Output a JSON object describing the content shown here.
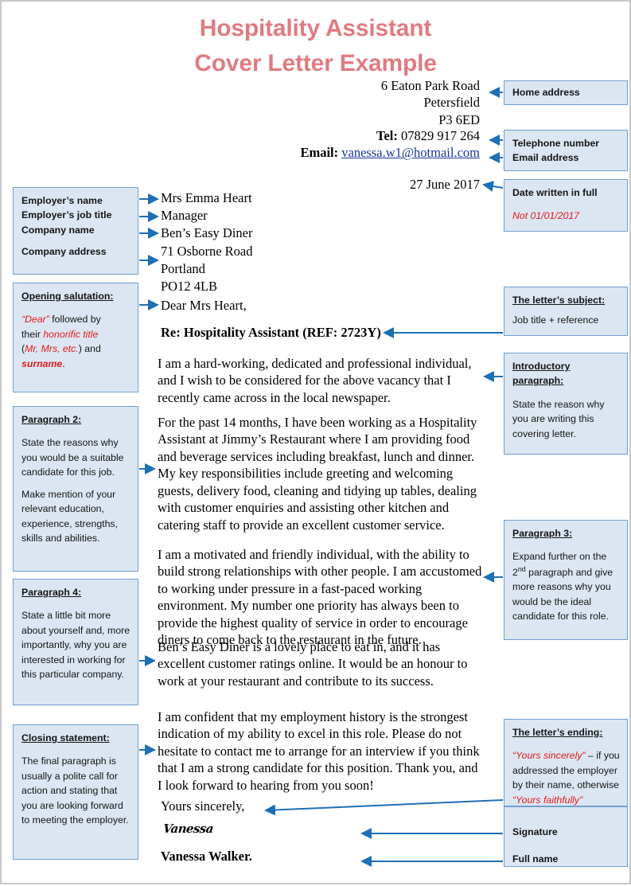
{
  "title": {
    "line1": "Hospitality Assistant",
    "line2": "Cover Letter Example",
    "color": "#e07b80"
  },
  "letter": {
    "home_address": [
      "6 Eaton Park Road",
      "Petersfield",
      "P3 6ED"
    ],
    "tel_label": "Tel:",
    "tel_value": " 07829 917 264",
    "email_label": "Email:",
    "email_value": "vanessa.w1@hotmail.com",
    "date": "27 June 2017",
    "employer": [
      "Mrs Emma Heart",
      "Manager",
      "Ben’s Easy Diner",
      "71 Osborne Road",
      "Portland",
      "PO12 4LB"
    ],
    "salutation": "Dear Mrs Heart,",
    "subject": "Re: Hospitality Assistant (REF: 2723Y)",
    "paragraph_1": "I am a hard-working, dedicated and professional individual, and I wish to be considered for the above vacancy that I recently came across in the local newspaper.",
    "paragraph_2": "For the past 14 months, I have been working as a Hospitality Assistant at Jimmy’s Restaurant where I am providing food and beverage services including breakfast, lunch and dinner. My key responsibilities include greeting and welcoming guests, delivery food, cleaning and tidying up tables, dealing with customer enquiries and assisting other kitchen and catering staff to provide an excellent customer service.",
    "paragraph_3": "I am a motivated and friendly individual, with the ability to build strong relationships with other people. I am accustomed to working under pressure in a fast-paced working environment.   My number one priority has always been to provide the highest quality of service in order to encourage diners to come back to the restaurant in the future.",
    "paragraph_4": "Ben’s Easy Diner is a lovely place to eat in, and it has excellent customer ratings online. It would be an honour to work at your restaurant and contribute to its success.",
    "paragraph_5": "I am confident that my employment history is the strongest indication of my ability to excel in this role. Please do not hesitate to contact me to arrange for an interview if you think that I am a strong candidate for this position. Thank you, and I look forward to hearing from you soon!",
    "signoff": "Yours sincerely,",
    "signature": "Vanessa",
    "full_name": "Vanessa Walker."
  },
  "annotations": {
    "home_address": {
      "label": "Home address"
    },
    "telephone": {
      "label": "Telephone number"
    },
    "email": {
      "label": "Email address"
    },
    "date": {
      "heading": "Date written in full",
      "note": "Not 01/01/2017"
    },
    "employer_box": {
      "line1": "Employer’s name",
      "line2": "Employer’s job title",
      "line3": "Company name",
      "line4": "Company address"
    },
    "salutation_box": {
      "heading": "Opening salutation:",
      "t1": "“Dear”",
      "t2": " followed by",
      "t3": "their ",
      "t4": "honorific title",
      "t5": "(",
      "t6": "Mr, Mrs, etc.",
      "t7": ") and",
      "t8": "surname",
      "t9": "."
    },
    "subject_box": {
      "heading": "The letter’s subject:",
      "body": "Job title + reference"
    },
    "intro_box": {
      "heading1": "Introductory",
      "heading2": "paragraph:",
      "body": "State the reason why you are writing this covering letter."
    },
    "paragraph2_box": {
      "heading": "Paragraph 2:",
      "body1": "State the reasons why you would be a suitable candidate for this job.",
      "body2": "Make mention of your relevant education, experience, strengths, skills and abilities."
    },
    "paragraph3_box": {
      "heading": "Paragraph 3:",
      "body_a": "Expand further on the",
      "body_ord": "2",
      "body_ord_sup": "nd",
      "body_b": " paragraph and give more reasons why you would be the ideal candidate for this role."
    },
    "paragraph4_box": {
      "heading": "Paragraph 4:",
      "body": "State a little bit more about yourself and, more importantly, why you are interested in working for this particular company."
    },
    "closing_box": {
      "heading": "Closing statement:",
      "body": "The final paragraph is usually a polite call for action and stating that you are looking forward to meeting the employer."
    },
    "ending_box": {
      "heading": "The letter’s ending:",
      "t1": "“Yours sincerely”",
      "t2": " – if you addressed the employer by their name, otherwise ",
      "t3": "“Yours faithfully”"
    },
    "signature_label": "Signature",
    "fullname_label": "Full name"
  },
  "colors": {
    "box_fill": "#dce6f2",
    "box_border": "#6f9fd0",
    "arrow": "#1f6fb5",
    "accent_red": "#e21b1b",
    "title": "#e07b80",
    "link": "#16379e"
  }
}
